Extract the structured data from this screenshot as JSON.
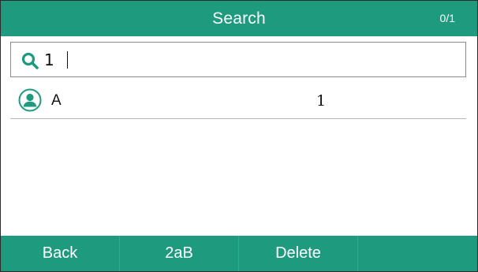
{
  "header": {
    "title": "Search",
    "page_counter": "0/1"
  },
  "search": {
    "value": "1",
    "icon": "search-icon"
  },
  "results": [
    {
      "name": "A",
      "number": "1",
      "icon": "contact-avatar-icon"
    }
  ],
  "softkeys": [
    {
      "label": "Back"
    },
    {
      "label": "2aB"
    },
    {
      "label": "Delete"
    },
    {
      "label": ""
    }
  ],
  "colors": {
    "accent": "#1e9b7f",
    "text": "#111111"
  }
}
